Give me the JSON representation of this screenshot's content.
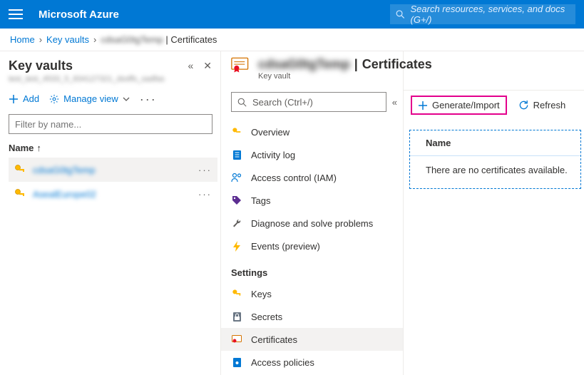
{
  "header": {
    "brand": "Microsoft Azure",
    "search_placeholder": "Search resources, services, and docs (G+/)"
  },
  "breadcrumb": {
    "home": "Home",
    "keyvaults": "Key vaults",
    "vault_name": "cdsaG0tgTemp",
    "section": "Certificates"
  },
  "left_panel": {
    "title": "Key vaults",
    "subtitle": "test_test_4533_5_834127321_dssffs_sadfas",
    "toolbar": {
      "add": "Add",
      "manage_view": "Manage view"
    },
    "filter_placeholder": "Filter by name...",
    "column": "Name",
    "items": [
      {
        "name": "cdsaG0tgTemp"
      },
      {
        "name": "AsealEurope02"
      }
    ]
  },
  "mid_panel": {
    "title_vault": "cdsaG0tgTemp",
    "title_section": "Certificates",
    "subtitle": "Key vault",
    "search_placeholder": "Search (Ctrl+/)",
    "nav": [
      {
        "label": "Overview",
        "icon": "keyvault"
      },
      {
        "label": "Activity log",
        "icon": "log"
      },
      {
        "label": "Access control (IAM)",
        "icon": "iam"
      },
      {
        "label": "Tags",
        "icon": "tag"
      },
      {
        "label": "Diagnose and solve problems",
        "icon": "wrench"
      },
      {
        "label": "Events (preview)",
        "icon": "bolt"
      }
    ],
    "settings_label": "Settings",
    "settings": [
      {
        "label": "Keys",
        "icon": "key"
      },
      {
        "label": "Secrets",
        "icon": "secret"
      },
      {
        "label": "Certificates",
        "icon": "cert",
        "active": true
      },
      {
        "label": "Access policies",
        "icon": "policy"
      }
    ]
  },
  "right_panel": {
    "generate": "Generate/Import",
    "refresh": "Refresh",
    "column": "Name",
    "empty": "There are no certificates available."
  }
}
